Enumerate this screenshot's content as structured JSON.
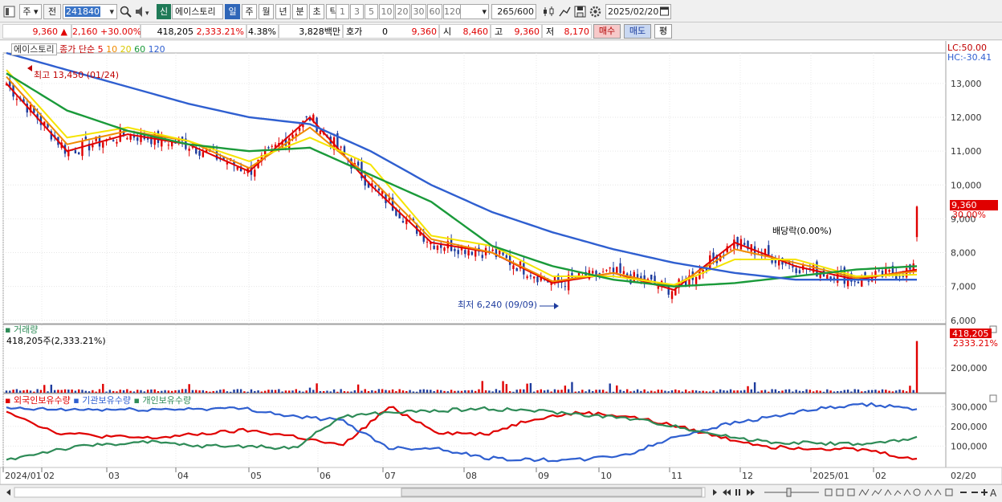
{
  "toolbar": {
    "market": "주",
    "prev_label": "전",
    "code": "241840",
    "badge": "신",
    "name": "에이스토리",
    "periods": [
      "일",
      "주",
      "월",
      "년",
      "분",
      "초",
      "틱"
    ],
    "active_period": "일",
    "intervals": [
      "1",
      "3",
      "5",
      "10",
      "20",
      "30",
      "60",
      "120"
    ],
    "count": "265",
    "count_total": "/600",
    "date": "2025/02/20"
  },
  "quote": {
    "price": "9,360",
    "arrow": "▲",
    "change": "2,160",
    "change_pct": "+30.00%",
    "volume": "418,205",
    "volume_ratio": "2,333.21%",
    "turnover": "4.38%",
    "amount": "3,828백만",
    "hoga_label": "호가",
    "hoga_value": "0",
    "hoga_price": "9,360",
    "open_label": "시",
    "open": "8,460",
    "high_label": "고",
    "high": "9,360",
    "low_label": "저",
    "low": "8,170",
    "buy_label": "매수",
    "sell_label": "매도",
    "eval_label": "평"
  },
  "price_panel": {
    "name_box": "에이스토리",
    "ma_title": "종가 단순",
    "ma_periods": [
      "5",
      "10",
      "20",
      "60",
      "120"
    ],
    "high_note": "최고 13,450 (01/24)",
    "low_note": "최저 6,240 (09/09)",
    "dividend_note": "배당락(0.00%)",
    "lc_label": "LC:50.00",
    "hc_label": "HC:-30.41",
    "current_price_tag": "9,360",
    "current_pct_tag": "30.00%",
    "y_ticks": [
      "13,000",
      "12,000",
      "11,000",
      "10,000",
      "9,000",
      "8,000",
      "7,000",
      "6,000"
    ]
  },
  "volume_panel": {
    "title": "거래량",
    "readout": "418,205주(2,333.21%)",
    "current_tag": "418,205",
    "current_pct": "2333.21%",
    "y_ticks": [
      "200,000"
    ]
  },
  "holding_panel": {
    "series": [
      "외국인보유수량",
      "기관보유수량",
      "개인보유수량"
    ],
    "y_ticks": [
      "300,000",
      "200,000",
      "100,000"
    ]
  },
  "x_axis": {
    "labels": [
      "2024/01",
      "02",
      "03",
      "04",
      "05",
      "06",
      "07",
      "08",
      "09",
      "10",
      "11",
      "12",
      "2025/01",
      "02"
    ],
    "end_label": "02/20"
  },
  "colors": {
    "up": "#e00000",
    "down": "#1e3c9e",
    "ma5": "#e00000",
    "ma10": "#f08a00",
    "ma20": "#f5e400",
    "ma60": "#1a9a3a",
    "ma120": "#2f5fd0",
    "foreign": "#e00000",
    "institution": "#2f5fd0",
    "individual": "#2e8b57"
  },
  "chart_data": {
    "type": "candlestick",
    "x": [
      "2024/01",
      "02",
      "03",
      "04",
      "05",
      "06",
      "07",
      "08",
      "09",
      "10",
      "11",
      "12",
      "2025/01",
      "02"
    ],
    "price_ylim": [
      5900,
      13900
    ],
    "key_points": [
      {
        "label": "high",
        "date": "01/24",
        "value": 13450
      },
      {
        "label": "low",
        "date": "09/09",
        "value": 6240
      },
      {
        "label": "last",
        "date": "02/20",
        "value": 9360
      }
    ],
    "ma_series": [
      {
        "name": "5",
        "values": [
          13000,
          11000,
          11500,
          11200,
          10400,
          12000,
          10000,
          8300,
          8000,
          7100,
          7400,
          6900,
          8300,
          7600,
          7200,
          7500
        ]
      },
      {
        "name": "10",
        "values": [
          13200,
          11200,
          11600,
          11300,
          10500,
          11700,
          10200,
          8400,
          8000,
          7150,
          7400,
          7000,
          8100,
          7700,
          7250,
          7450
        ]
      },
      {
        "name": "20",
        "values": [
          13400,
          11400,
          11700,
          11300,
          10700,
          11400,
          10600,
          8500,
          8200,
          7300,
          7300,
          7050,
          7800,
          7800,
          7300,
          7350
        ]
      },
      {
        "name": "60",
        "values": [
          13300,
          12200,
          11600,
          11200,
          11000,
          11100,
          10300,
          9500,
          8200,
          7600,
          7200,
          7000,
          7100,
          7300,
          7500,
          7600
        ]
      },
      {
        "name": "120",
        "values": [
          13900,
          13400,
          12900,
          12400,
          12000,
          11800,
          11000,
          10000,
          9200,
          8600,
          8100,
          7700,
          7400,
          7200,
          7200,
          7200
        ]
      }
    ],
    "holding": {
      "ylim": [
        0,
        350000
      ],
      "series": [
        {
          "name": "외국인보유수량",
          "values": [
            280000,
            170000,
            150000,
            140000,
            160000,
            180000,
            150000,
            100000,
            300000,
            170000,
            160000,
            240000,
            270000,
            250000,
            200000,
            140000,
            95000,
            90000,
            80000,
            30000
          ]
        },
        {
          "name": "기관보유수량",
          "values": [
            290000,
            285000,
            285000,
            285000,
            290000,
            290000,
            250000,
            230000,
            90000,
            90000,
            40000,
            30000,
            30000,
            60000,
            150000,
            210000,
            250000,
            290000,
            310000,
            290000
          ]
        },
        {
          "name": "개인보유수량",
          "values": [
            30000,
            80000,
            110000,
            120000,
            100000,
            100000,
            90000,
            250000,
            270000,
            280000,
            290000,
            280000,
            260000,
            240000,
            200000,
            150000,
            120000,
            115000,
            110000,
            140000
          ]
        }
      ]
    }
  }
}
